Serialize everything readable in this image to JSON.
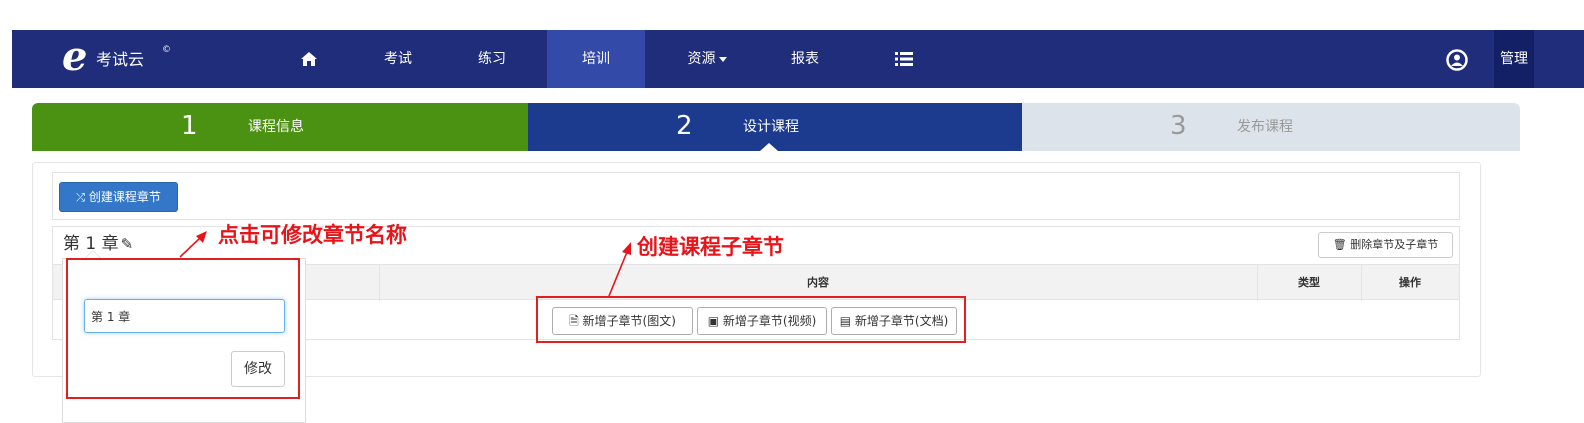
{
  "navbar": {
    "logo_mark": "e",
    "logo_text": "考试云",
    "logo_sup": "©",
    "items": [
      {
        "icon": "home-icon"
      },
      {
        "label": "考试"
      },
      {
        "label": "练习"
      },
      {
        "label": "培训"
      },
      {
        "label": "资源"
      },
      {
        "label": "报表"
      },
      {
        "icon": "list-icon"
      }
    ],
    "admin_label": "管理"
  },
  "wizard": {
    "steps": [
      {
        "num": "1",
        "label": "课程信息"
      },
      {
        "num": "2",
        "label": "设计课程"
      },
      {
        "num": "3",
        "label": "发布课程"
      }
    ]
  },
  "toolbar": {
    "create_chapter": "创建课程章节"
  },
  "chapter": {
    "title": "第 1 章",
    "delete_button": "删除章节及子章节",
    "columns": [
      "内容",
      "类型",
      "操作"
    ],
    "add_buttons": [
      "新增子章节(图文)",
      "新增子章节(视频)",
      "新增子章节(文档)"
    ]
  },
  "popover": {
    "input_value": "第 1 章",
    "modify_button": "修改"
  },
  "annotations": {
    "left": "点击可修改章节名称",
    "right": "创建课程子章节"
  },
  "colors": {
    "navbar": "#1f2d7a",
    "nav_active": "#344aa8",
    "step_done": "#4b9212",
    "step_current": "#1c3b8f",
    "step_pending": "#dde3ea",
    "primary_button": "#3477c8",
    "annotation_red": "#e8141a"
  }
}
